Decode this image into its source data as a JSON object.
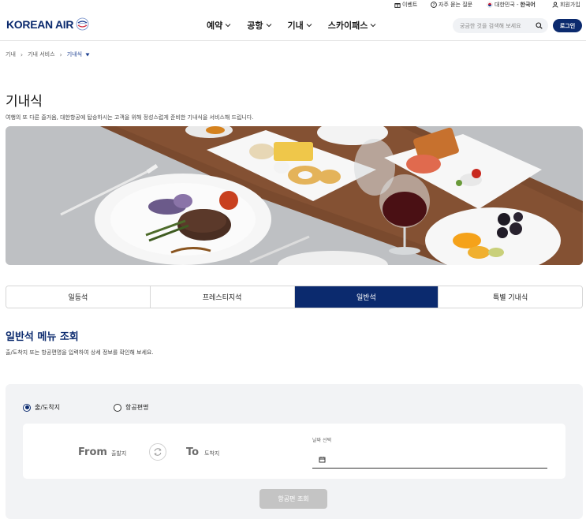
{
  "utility": {
    "events": "이벤트",
    "faq": "자주 묻는 질문",
    "region_prefix": "대한민국 -",
    "region_lang": "한국어",
    "signup": "회원가입"
  },
  "header": {
    "logo_text": "KOREAN AIR",
    "nav": [
      {
        "label": "예약"
      },
      {
        "label": "공항"
      },
      {
        "label": "기내"
      },
      {
        "label": "스카이패스"
      }
    ],
    "search_placeholder": "궁금한 것을 검색해 보세요",
    "login_label": "로그인"
  },
  "breadcrumb": [
    "기내",
    "기내 서비스",
    "기내식"
  ],
  "page": {
    "title": "기내식",
    "description": "여행의 또 다른 즐거움, 대한항공에 탑승하시는 고객을 위해 정성스럽게 준비한 기내식을 서비스해 드립니다."
  },
  "tabs": [
    {
      "label": "일등석",
      "active": false
    },
    {
      "label": "프레스티지석",
      "active": false
    },
    {
      "label": "일반석",
      "active": true
    },
    {
      "label": "특별 기내식",
      "active": false
    }
  ],
  "menu_section": {
    "title": "일반석 메뉴 조회",
    "description": "출/도착지 또는 항공편명을 입력하여 상세 정보를 확인해 보세요."
  },
  "search_panel": {
    "radio_route": "출/도착지",
    "radio_flight": "항공편명",
    "from_label": "From",
    "from_placeholder": "출발지",
    "to_label": "To",
    "to_placeholder": "도착지",
    "date_label": "날짜 선택",
    "submit_label": "항공편 조회"
  },
  "colors": {
    "brand_navy": "#0b2a6e",
    "disabled_button": "#c4c4c4",
    "panel_bg": "#f2f3f5"
  }
}
